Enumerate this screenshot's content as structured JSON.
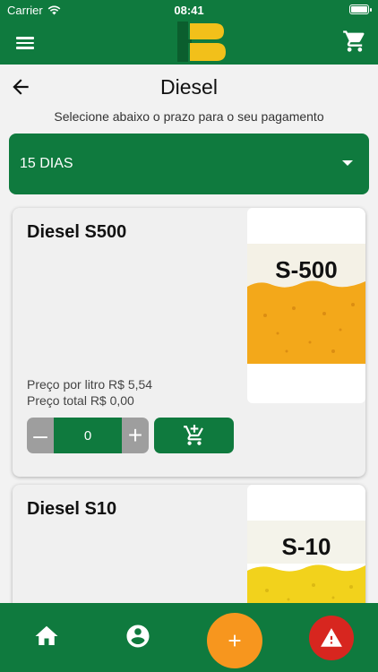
{
  "status_bar": {
    "carrier": "Carrier",
    "time": "08:41"
  },
  "header": {
    "menu_icon": "menu-icon",
    "cart_icon": "cart-icon",
    "logo": "app-logo"
  },
  "page": {
    "title": "Diesel",
    "subtitle": "Selecione abaixo o prazo para o seu pagamento"
  },
  "payment_select": {
    "value": "15 DIAS"
  },
  "products": [
    {
      "name": "Diesel S500",
      "image_label": "S-500",
      "price_per_liter": "Preço por litro R$ 5,54",
      "total_price": "Preço total R$ 0,00",
      "quantity": "0",
      "fuel_color": "#f3a81a"
    },
    {
      "name": "Diesel S10",
      "image_label": "S-10",
      "fuel_color": "#f2d21c"
    }
  ],
  "quantity_controls": {
    "minus": "–",
    "plus": "+"
  },
  "colors": {
    "primary": "#0f7a3e",
    "fab": "#f7961e",
    "alert": "#d7261f",
    "stepper": "#9e9e9e"
  },
  "bottom_nav": {
    "home_icon": "home-icon",
    "profile_icon": "account-icon",
    "fab_icon": "plus-icon",
    "alert_icon": "warning-icon"
  }
}
